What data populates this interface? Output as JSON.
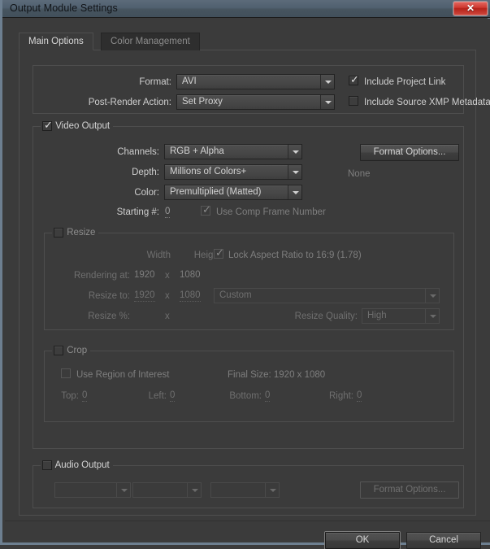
{
  "window": {
    "title": "Output Module Settings",
    "close_glyph": "✕"
  },
  "tabs": [
    {
      "label": "Main Options",
      "active": true
    },
    {
      "label": "Color Management",
      "active": false
    }
  ],
  "format_section": {
    "format_label": "Format:",
    "format_value": "AVI",
    "post_render_label": "Post-Render Action:",
    "post_render_value": "Set Proxy",
    "include_project_link_label": "Include Project Link",
    "include_project_link_checked": true,
    "include_xmp_label": "Include Source XMP Metadata",
    "include_xmp_checked": false
  },
  "video_output": {
    "legend": "Video Output",
    "enabled": true,
    "channels_label": "Channels:",
    "channels_value": "RGB + Alpha",
    "depth_label": "Depth:",
    "depth_value": "Millions of Colors+",
    "color_label": "Color:",
    "color_value": "Premultiplied (Matted)",
    "starting_num_label": "Starting #:",
    "starting_num_value": "0",
    "use_comp_frame_label": "Use Comp Frame Number",
    "use_comp_frame_checked": true,
    "format_options_label": "Format Options...",
    "format_options_status": "None"
  },
  "resize": {
    "legend": "Resize",
    "enabled": false,
    "width_header": "Width",
    "height_header": "Height",
    "rendering_at_label": "Rendering at:",
    "rendering_at_width": "1920",
    "rendering_at_x": "x",
    "rendering_at_height": "1080",
    "resize_to_label": "Resize to:",
    "resize_to_width": "1920",
    "resize_to_x": "x",
    "resize_to_height": "1080",
    "resize_pct_label": "Resize %:",
    "resize_pct_x": "x",
    "lock_aspect_label": "Lock Aspect Ratio to 16:9 (1.78)",
    "lock_aspect_checked": true,
    "preset_value": "Custom",
    "resize_quality_label": "Resize Quality:",
    "resize_quality_value": "High"
  },
  "crop": {
    "legend": "Crop",
    "enabled": false,
    "use_roi_label": "Use Region of Interest",
    "use_roi_checked": false,
    "final_size_label": "Final Size: 1920 x 1080",
    "top_label": "Top:",
    "top_value": "0",
    "left_label": "Left:",
    "left_value": "0",
    "bottom_label": "Bottom:",
    "bottom_value": "0",
    "right_label": "Right:",
    "right_value": "0"
  },
  "audio_output": {
    "legend": "Audio Output",
    "enabled": false,
    "rate_value": "",
    "bitdepth_value": "",
    "channels_value": "",
    "format_options_label": "Format Options..."
  },
  "footer": {
    "ok_label": "OK",
    "cancel_label": "Cancel"
  },
  "colors": {
    "dialog_bg": "#3b3b3b",
    "titlebar": "#50606f",
    "window_border": "#6d7f90",
    "close_red": "#cf3a32",
    "text": "#cfcfcf",
    "text_disabled": "#7e7e7e"
  }
}
